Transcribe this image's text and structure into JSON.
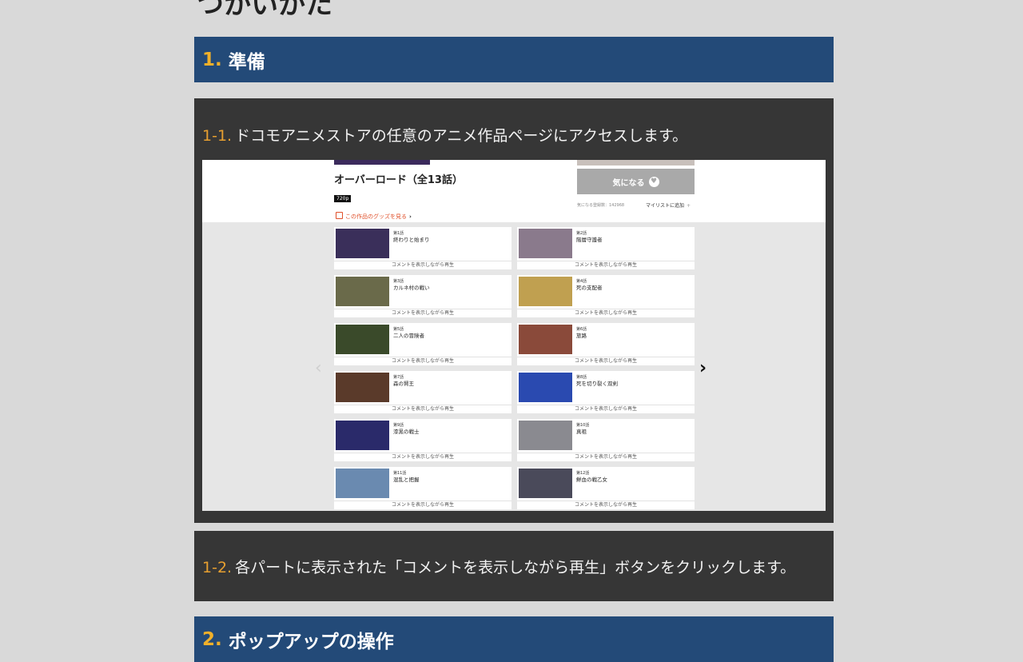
{
  "page": {
    "heading": "つかいかた"
  },
  "sections": [
    {
      "num": "1.",
      "title": "準備"
    },
    {
      "num": "2.",
      "title": "ポップアップの操作"
    }
  ],
  "steps": [
    {
      "num": "1-1.",
      "text": "ドコモアニメストアの任意のアニメ作品ページにアクセスします。"
    },
    {
      "num": "1-2.",
      "text": "各パートに表示された「コメントを表示しながら再生」ボタンをクリックします。"
    }
  ],
  "screenshot": {
    "title": "オーバーロード（全13話）",
    "quality_badge": "720p",
    "goods_link": "この作品のグッズを見る",
    "fav_button": "気になる",
    "fav_count": "気になる登録数：142968",
    "mylist": "マイリストに追加",
    "comment_play_label": "コメントを表示しながら再生",
    "episodes": [
      {
        "no": "第1話",
        "title": "終わりと始まり",
        "thumb_color": "#3a2f5a"
      },
      {
        "no": "第2話",
        "title": "階層守護者",
        "thumb_color": "#8a7a8c"
      },
      {
        "no": "第3話",
        "title": "カルネ村の戦い",
        "thumb_color": "#6a6a4a"
      },
      {
        "no": "第4話",
        "title": "死の支配者",
        "thumb_color": "#c0a050"
      },
      {
        "no": "第5話",
        "title": "二人の冒険者",
        "thumb_color": "#3a4a2a"
      },
      {
        "no": "第6話",
        "title": "旅路",
        "thumb_color": "#8a4a3a"
      },
      {
        "no": "第7話",
        "title": "森の賢王",
        "thumb_color": "#5a3a2a"
      },
      {
        "no": "第8話",
        "title": "死を切り裂く双剣",
        "thumb_color": "#2a4ab0"
      },
      {
        "no": "第9話",
        "title": "漆黒の戦士",
        "thumb_color": "#2a2a6a"
      },
      {
        "no": "第10話",
        "title": "真祖",
        "thumb_color": "#8a8a90"
      },
      {
        "no": "第11話",
        "title": "混乱と把握",
        "thumb_color": "#6a8ab0"
      },
      {
        "no": "第12話",
        "title": "鮮血の戦乙女",
        "thumb_color": "#4a4a5a"
      }
    ]
  },
  "icons": {
    "prev": "‹",
    "next": "›",
    "heart": "♥",
    "goods_chevron": "›",
    "plus": "+"
  }
}
